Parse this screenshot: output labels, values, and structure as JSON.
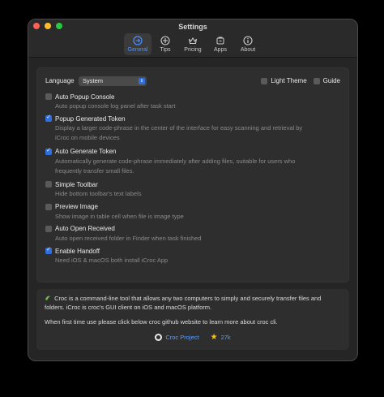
{
  "window": {
    "title": "Settings"
  },
  "tabs": [
    {
      "label": "General",
      "icon": "general-icon",
      "active": true
    },
    {
      "label": "Tips",
      "icon": "tips-icon",
      "active": false
    },
    {
      "label": "Pricing",
      "icon": "pricing-icon",
      "active": false
    },
    {
      "label": "Apps",
      "icon": "apps-icon",
      "active": false
    },
    {
      "label": "About",
      "icon": "about-icon",
      "active": false
    }
  ],
  "language": {
    "label": "Language",
    "value": "System"
  },
  "options": {
    "light_theme": {
      "label": "Light Theme",
      "checked": false
    },
    "guide": {
      "label": "Guide",
      "checked": false
    }
  },
  "settings": [
    {
      "label": "Auto Popup Console",
      "desc": "Auto popup console log panel after task start",
      "checked": false
    },
    {
      "label": "Popup Generated Token",
      "desc": "Display a larger code-phrase in the center of the interface for easy scanning and retrieval by",
      "desc2": "iCroc on mobile devices",
      "checked": true
    },
    {
      "label": "Auto Generate Token",
      "desc": "Automatically generate code-phrase immediately after adding files, suitable for users who",
      "desc2": "frequently transfer small files.",
      "checked": true
    },
    {
      "label": "Simple Toolbar",
      "desc": "Hide bottom toolbar's text labels",
      "checked": false
    },
    {
      "label": "Preview Image",
      "desc": "Show image in table cell when file is image type",
      "checked": false
    },
    {
      "label": "Auto Open Received",
      "desc": "Auto open received folder in Finder when task finished",
      "checked": false
    },
    {
      "label": "Enable Handoff",
      "desc": "Need iOS & macOS both install iCroc App",
      "checked": true
    }
  ],
  "about": {
    "line1": "Croc is a command-line tool that allows any two computers to simply and securely transfer files and folders. iCroc is croc's GUI client on iOS and macOS platform.",
    "line2": "When first time use please click below croc github website to learn more about croc cli.",
    "project_link": "Croc Project",
    "stars": "27k"
  },
  "colors": {
    "accent": "#2f6fe0",
    "link": "#5b9cff",
    "star": "#f5c518"
  }
}
